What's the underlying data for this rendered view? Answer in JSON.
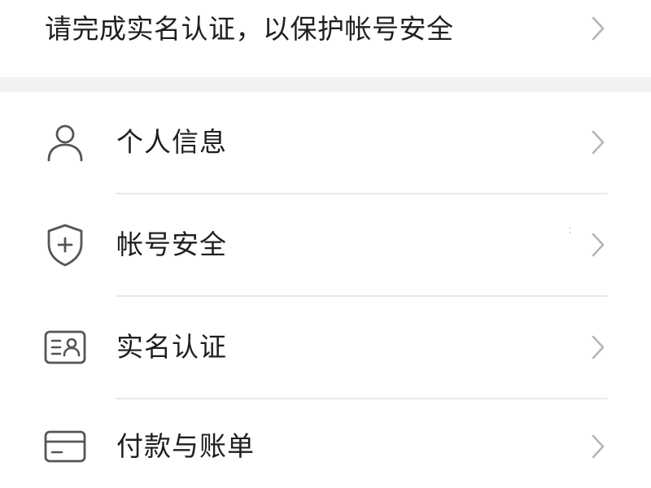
{
  "banner": {
    "text": "请完成实名认证，以保护帐号安全"
  },
  "menu": {
    "items": [
      {
        "label": "个人信息",
        "icon": "person-icon"
      },
      {
        "label": "帐号安全",
        "icon": "shield-plus-icon"
      },
      {
        "label": "实名认证",
        "icon": "id-card-icon"
      },
      {
        "label": "付款与账单",
        "icon": "credit-card-icon"
      }
    ]
  },
  "colors": {
    "text": "#1f1f1f",
    "icon": "#555555",
    "chevron": "#b5b5b5",
    "divider": "#e9e9e9",
    "section_gap": "#f2f2f2"
  }
}
